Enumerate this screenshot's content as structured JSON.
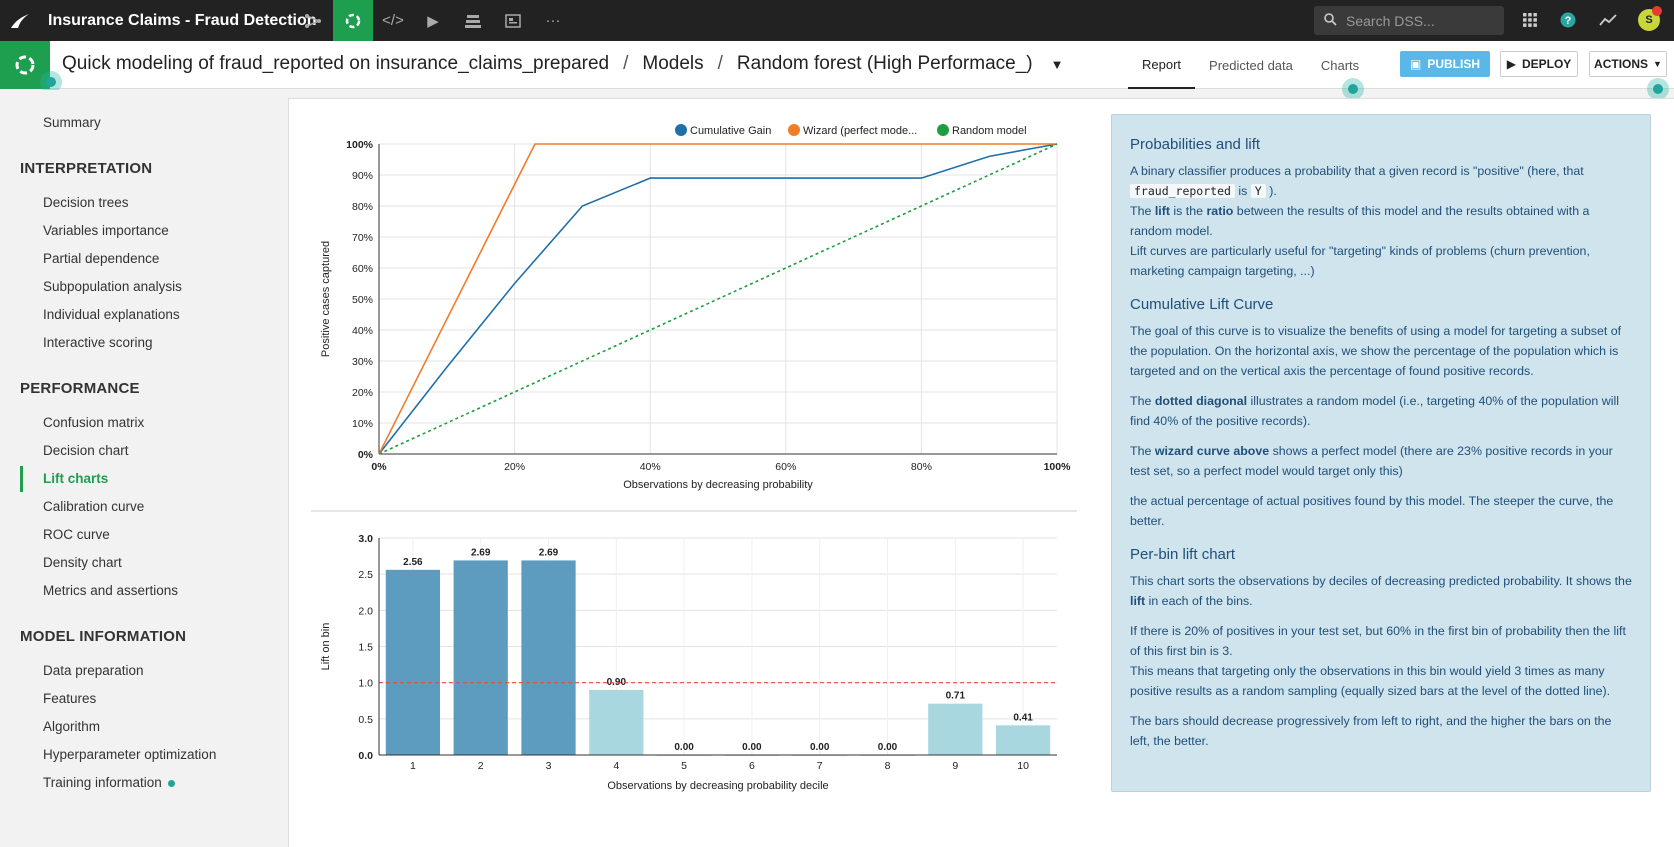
{
  "topbar": {
    "title": "Insurance Claims - Fraud Detection",
    "search_placeholder": "Search DSS...",
    "avatar_initial": "S"
  },
  "subbar": {
    "crumb_project": "Quick modeling of fraud_reported on insurance_claims_prepared",
    "crumb_models": "Models",
    "crumb_model": "Random forest (High Performace_)",
    "tabs": [
      "Report",
      "Predicted data",
      "Charts"
    ],
    "publish": "PUBLISH",
    "deploy": "DEPLOY",
    "actions": "ACTIONS"
  },
  "sidebar": {
    "summary": "Summary",
    "interpretation_head": "INTERPRETATION",
    "interpretation": [
      "Decision trees",
      "Variables importance",
      "Partial dependence",
      "Subpopulation analysis",
      "Individual explanations",
      "Interactive scoring"
    ],
    "performance_head": "PERFORMANCE",
    "performance": [
      "Confusion matrix",
      "Decision chart",
      "Lift charts",
      "Calibration curve",
      "ROC curve",
      "Density chart",
      "Metrics and assertions"
    ],
    "model_info_head": "MODEL INFORMATION",
    "model_info": [
      "Data preparation",
      "Features",
      "Algorithm",
      "Hyperparameter optimization",
      "Training information"
    ]
  },
  "colors": {
    "gain": "#1f6fa8",
    "wizard": "#f07d2a",
    "random": "#1e9e3c",
    "bar_dark": "#5d9bbf",
    "bar_light": "#a9d7e0",
    "brand_green": "#1e9e4f"
  },
  "chart_data": [
    {
      "type": "line",
      "xlabel": "Observations by decreasing probability",
      "ylabel": "Positive cases captured",
      "xticks": [
        "0%",
        "20%",
        "40%",
        "60%",
        "80%",
        "100%"
      ],
      "yticks": [
        "0%",
        "10%",
        "20%",
        "30%",
        "40%",
        "50%",
        "60%",
        "70%",
        "80%",
        "90%",
        "100%"
      ],
      "xlim": [
        0,
        100
      ],
      "ylim": [
        0,
        100
      ],
      "legend_position": "top-right",
      "series": [
        {
          "name": "Cumulative Gain",
          "x": [
            0,
            10,
            20,
            30,
            40,
            50,
            60,
            70,
            80,
            90,
            100
          ],
          "y": [
            0,
            28,
            55,
            80,
            89,
            89,
            89,
            89,
            89,
            96,
            100
          ]
        },
        {
          "name": "Wizard (perfect mode...",
          "x": [
            0,
            23,
            100
          ],
          "y": [
            0,
            100,
            100
          ]
        },
        {
          "name": "Random model",
          "x": [
            0,
            100
          ],
          "y": [
            0,
            100
          ]
        }
      ]
    },
    {
      "type": "bar",
      "xlabel": "Observations by decreasing probability decile",
      "ylabel": "Lift on bin",
      "categories": [
        "1",
        "2",
        "3",
        "4",
        "5",
        "6",
        "7",
        "8",
        "9",
        "10"
      ],
      "values": [
        2.56,
        2.69,
        2.69,
        0.9,
        0.0,
        0.0,
        0.0,
        0.0,
        0.71,
        0.41
      ],
      "value_labels": [
        "2.56",
        "2.69",
        "2.69",
        "0.90",
        "0.00",
        "0.00",
        "0.00",
        "0.00",
        "0.71",
        "0.41"
      ],
      "yticks": [
        "0.0",
        "0.5",
        "1.0",
        "1.5",
        "2.0",
        "2.5",
        "3.0"
      ],
      "ylim": [
        0,
        3
      ],
      "reference_line": 1.0
    }
  ],
  "help": {
    "h1": "Probabilities and lift",
    "p1a": "A binary classifier produces a probability that a given record is \"positive\" (here, that",
    "p1_code1": "fraud_reported",
    "p1_is": "is",
    "p1_code2": "Y",
    "p1_end": ").",
    "p2_pre": "The",
    "p2_b1": "lift",
    "p2_mid": "is the",
    "p2_b2": "ratio",
    "p2_post": "between the results of this model and the results obtained with a random model.",
    "p3": "Lift curves are particularly useful for \"targeting\" kinds of problems (churn prevention, marketing campaign targeting, ...)",
    "h2": "Cumulative Lift Curve",
    "p4": "The goal of this curve is to visualize the benefits of using a model for targeting a subset of the population. On the horizontal axis, we show the percentage of the population which is targeted and on the vertical axis the percentage of found positive records.",
    "p5_pre": "The",
    "p5_b": "dotted diagonal",
    "p5_post": "illustrates a random model (i.e., targeting 40% of the population will find 40% of the positive records).",
    "p6_pre": "The",
    "p6_b": "wizard curve above",
    "p6_post": "shows a perfect model (there are 23% positive records in your test set, so a perfect model would target only this)",
    "p7": "the actual percentage of actual positives found by this model. The steeper the curve, the better.",
    "h3": "Per-bin lift chart",
    "p8_pre": "This chart sorts the observations by deciles of decreasing predicted probability. It shows the",
    "p8_b": "lift",
    "p8_post": "in each of the bins.",
    "p9": "If there is 20% of positives in your test set, but 60% in the first bin of probability then the lift of this first bin is 3.",
    "p10": "This means that targeting only the observations in this bin would yield 3 times as many positive results as a random sampling (equally sized bars at the level of the dotted line).",
    "p11": "The bars should decrease progressively from left to right, and the higher the bars on the left, the better."
  }
}
